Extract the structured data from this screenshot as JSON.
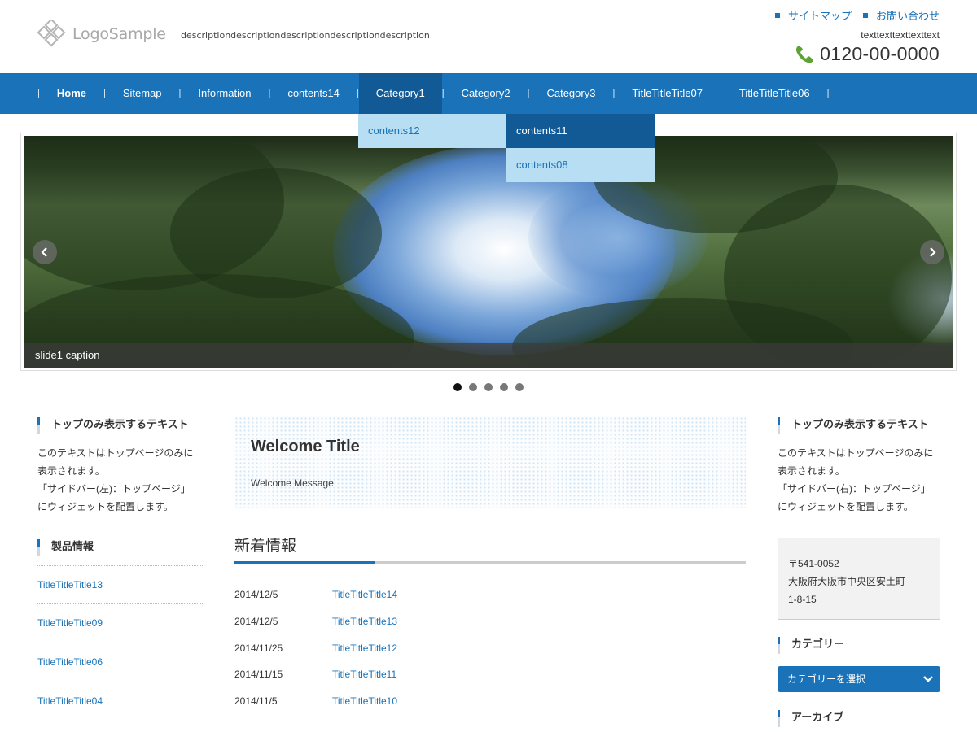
{
  "header": {
    "logo_text": "LogoSample",
    "description": "descriptiondescriptiondescriptiondescriptiondescription",
    "top_links": [
      "サイトマップ",
      "お問い合わせ"
    ],
    "tel_note": "texttexttexttexttext",
    "tel_number": "0120-00-0000"
  },
  "nav": {
    "items": [
      "Home",
      "Sitemap",
      "Information",
      "contents14",
      "Category1",
      "Category2",
      "Category3",
      "TitleTitleTitle07",
      "TitleTitleTitle06"
    ],
    "active": "Category1",
    "dropdown": {
      "level1": "contents12",
      "level2": [
        "contents11",
        "contents08"
      ]
    }
  },
  "slider": {
    "caption": "slide1 caption",
    "slide_count": 5,
    "active_index": 0
  },
  "left_sidebar": {
    "widget1_title": "トップのみ表示するテキスト",
    "widget1_lines": [
      "このテキストはトップページのみに",
      "表示されます。",
      "「サイドバー(左)：トップページ」",
      "にウィジェットを配置します。"
    ],
    "widget2_title": "製品情報",
    "products": [
      "TitleTitleTitle13",
      "TitleTitleTitle09",
      "TitleTitleTitle06",
      "TitleTitleTitle04"
    ]
  },
  "main": {
    "welcome_title": "Welcome Title",
    "welcome_message": "Welcome Message",
    "news_heading": "新着情報",
    "news": [
      {
        "date": "2014/12/5",
        "title": "TitleTitleTitle14"
      },
      {
        "date": "2014/12/5",
        "title": "TitleTitleTitle13"
      },
      {
        "date": "2014/11/25",
        "title": "TitleTitleTitle12"
      },
      {
        "date": "2014/11/15",
        "title": "TitleTitleTitle11"
      },
      {
        "date": "2014/11/5",
        "title": "TitleTitleTitle10"
      }
    ]
  },
  "right_sidebar": {
    "widget1_title": "トップのみ表示するテキスト",
    "widget1_lines": [
      "このテキストはトップページのみに",
      "表示されます。",
      "「サイドバー(右)：トップページ」",
      "にウィジェットを配置します。"
    ],
    "address_lines": [
      "〒541-0052",
      "大阪府大阪市中央区安土町",
      "1-8-15"
    ],
    "category_title": "カテゴリー",
    "category_select": "カテゴリーを選択",
    "archive_title": "アーカイブ"
  },
  "colors": {
    "accent": "#1a73b8",
    "nav_active": "#125a96",
    "dropdown_light": "#b8def3"
  }
}
